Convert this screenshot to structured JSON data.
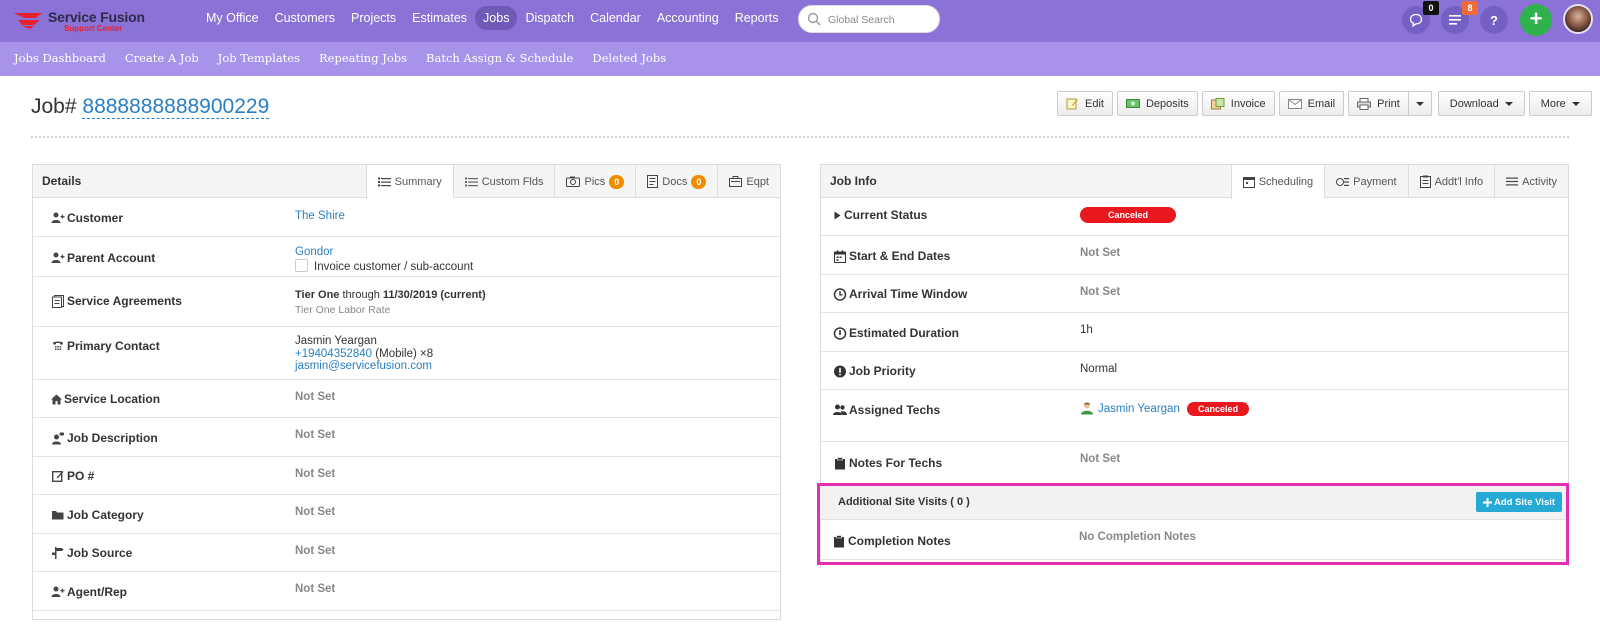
{
  "brand": {
    "name": "Service Fusion",
    "tagline": "Support Center"
  },
  "nav": {
    "items": [
      {
        "label": "My Office",
        "name": "nav-my-office"
      },
      {
        "label": "Customers",
        "name": "nav-customers"
      },
      {
        "label": "Projects",
        "name": "nav-projects"
      },
      {
        "label": "Estimates",
        "name": "nav-estimates"
      },
      {
        "label": "Jobs",
        "name": "nav-jobs",
        "active": true
      },
      {
        "label": "Dispatch",
        "name": "nav-dispatch"
      },
      {
        "label": "Calendar",
        "name": "nav-calendar"
      },
      {
        "label": "Accounting",
        "name": "nav-accounting"
      },
      {
        "label": "Reports",
        "name": "nav-reports"
      }
    ],
    "search_placeholder": "Global Search",
    "chat_count": "0",
    "notif_count": "8",
    "help": "?"
  },
  "subnav": {
    "items": [
      "Jobs Dashboard",
      "Create A Job",
      "Job Templates",
      "Repeating Jobs",
      "Batch Assign & Schedule",
      "Deleted Jobs"
    ]
  },
  "job": {
    "prefix": "Job#",
    "number": "8888888888900229"
  },
  "actions": {
    "edit": "Edit",
    "deposits": "Deposits",
    "invoice": "Invoice",
    "email": "Email",
    "print": "Print",
    "download": "Download",
    "more": "More"
  },
  "details": {
    "title": "Details",
    "tabs": {
      "summary": "Summary",
      "custom": "Custom Flds",
      "pics": "Pics",
      "pics_count": "0",
      "docs": "Docs",
      "docs_count": "0",
      "eqpt": "Eqpt"
    },
    "rows": {
      "customer": {
        "label": "Customer",
        "value": "The Shire"
      },
      "parent": {
        "label": "Parent Account",
        "value": "Gondor",
        "checkbox_label": "Invoice customer / sub-account"
      },
      "agreements": {
        "label": "Service Agreements",
        "tier": "Tier One",
        "through": "through",
        "date": "11/30/2019",
        "current": "(current)",
        "rate": "Tier One Labor Rate"
      },
      "contact": {
        "label": "Primary Contact",
        "name": "Jasmin Yeargan",
        "phone": "+19404352840",
        "phone_type": "(Mobile) ×8",
        "email": "jasmin@servicefusion.com"
      },
      "location": {
        "label": "Service Location",
        "value": "Not Set"
      },
      "description": {
        "label": "Job Description",
        "value": "Not Set"
      },
      "po": {
        "label": "PO #",
        "value": "Not Set"
      },
      "category": {
        "label": "Job Category",
        "value": "Not Set"
      },
      "source": {
        "label": "Job Source",
        "value": "Not Set"
      },
      "agent": {
        "label": "Agent/Rep",
        "value": "Not Set"
      }
    }
  },
  "jobinfo": {
    "title": "Job Info",
    "tabs": {
      "scheduling": "Scheduling",
      "payment": "Payment",
      "addl": "Addt'l Info",
      "activity": "Activity"
    },
    "rows": {
      "status": {
        "label": "Current Status",
        "value": "Canceled"
      },
      "dates": {
        "label": "Start & End Dates",
        "value": "Not Set"
      },
      "arrival": {
        "label": "Arrival Time Window",
        "value": "Not Set"
      },
      "duration": {
        "label": "Estimated Duration",
        "value": "1h"
      },
      "priority": {
        "label": "Job Priority",
        "value": "Normal"
      },
      "techs": {
        "label": "Assigned Techs",
        "name": "Jasmin Yeargan",
        "status": "Canceled"
      },
      "notes": {
        "label": "Notes For Techs",
        "value": "Not Set"
      },
      "site_visits": {
        "label": "Additional Site Visits ( 0 )",
        "button": "Add Site Visit"
      },
      "completion": {
        "label": "Completion Notes",
        "value": "No Completion Notes"
      }
    }
  },
  "colors": {
    "nav": "#8a72d6",
    "subnav": "#a893ea",
    "link": "#2a7fc2",
    "cancel": "#e8181e",
    "highlight": "#e22fb6",
    "accent": "#27a9d6"
  }
}
